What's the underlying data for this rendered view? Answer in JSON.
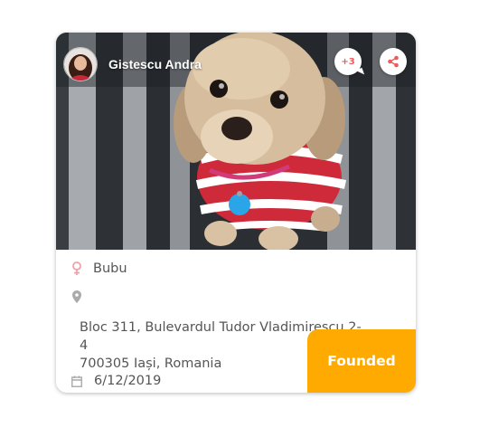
{
  "card": {
    "owner_name": "Gistescu Andra",
    "comment_count": "+3",
    "pet_name": "Bubu",
    "address_line1": "Bloc 311, Bulevardul Tudor Vladimirescu 2-4",
    "address_line2": "700305 Iași, Romania",
    "date": "6/12/2019",
    "status": "Founded"
  },
  "icons": {
    "gender": "female-icon",
    "location": "location-pin-icon",
    "date": "calendar-icon",
    "share": "share-icon",
    "comments": "comment-bubble-icon"
  },
  "colors": {
    "status_bg": "#ffaa00",
    "accent": "#ef5a5a",
    "gender_icon": "#f4a0a8",
    "muted_icon": "#aaaaaa",
    "text": "#555555"
  }
}
